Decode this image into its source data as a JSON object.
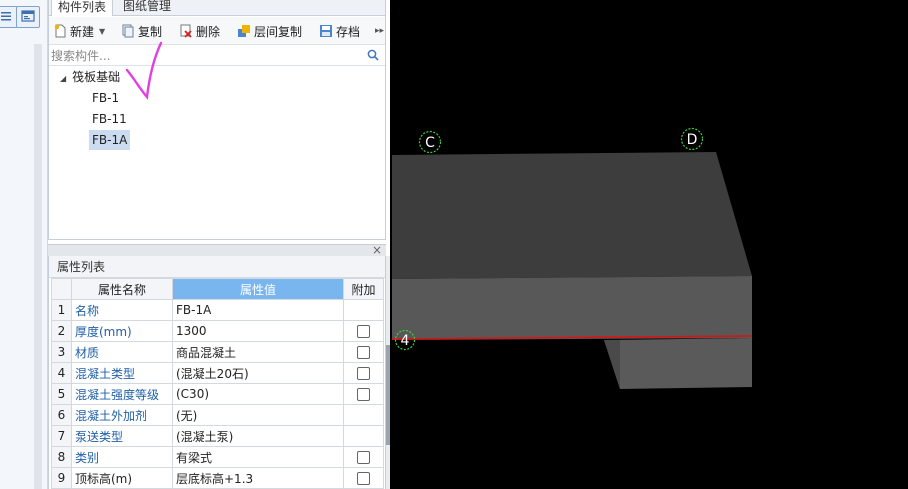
{
  "left_strip": {
    "buttons": [
      {
        "icon": "list-icon"
      },
      {
        "icon": "layout-icon"
      }
    ]
  },
  "component_panel": {
    "tabs": [
      {
        "label": "构件列表",
        "active": true
      },
      {
        "label": "图纸管理",
        "active": false
      }
    ],
    "toolbar": {
      "new_label": "新建",
      "copy_label": "复制",
      "delete_label": "删除",
      "floor_copy_label": "层间复制",
      "save_label": "存档",
      "more_label": "▸▸"
    },
    "search": {
      "placeholder": "搜索构件..."
    },
    "tree": {
      "root_label": "筏板基础",
      "items": [
        {
          "label": "FB-1",
          "selected": false
        },
        {
          "label": "FB-11",
          "selected": false
        },
        {
          "label": "FB-1A",
          "selected": true
        }
      ]
    }
  },
  "splitter": {
    "close_label": "×"
  },
  "property_panel": {
    "title": "属性列表",
    "headers": {
      "name": "属性名称",
      "value": "属性值",
      "extra": "附加"
    },
    "rows": [
      {
        "num": "1",
        "name": "名称",
        "value": "FB-1A",
        "checkbox": false
      },
      {
        "num": "2",
        "name": "厚度(mm)",
        "value": "1300",
        "checkbox": true
      },
      {
        "num": "3",
        "name": "材质",
        "value": "商品混凝土",
        "checkbox": true
      },
      {
        "num": "4",
        "name": "混凝土类型",
        "value": "(混凝土20石)",
        "checkbox": true
      },
      {
        "num": "5",
        "name": "混凝土强度等级",
        "value": "(C30)",
        "checkbox": true
      },
      {
        "num": "6",
        "name": "混凝土外加剂",
        "value": "(无)",
        "checkbox": false
      },
      {
        "num": "7",
        "name": "泵送类型",
        "value": "(混凝土泵)",
        "checkbox": false
      },
      {
        "num": "8",
        "name": "类别",
        "value": "有梁式",
        "checkbox": true
      },
      {
        "num": "9",
        "name": "顶标高(m)",
        "value": "层底标高+1.3",
        "checkbox": true
      }
    ]
  },
  "viewport": {
    "axis_labels": [
      "C",
      "D",
      "4"
    ],
    "colors": {
      "background": "#000000",
      "slab_top": "#3d3d3d",
      "slab_front": "#585858",
      "slab_side": "#4e4e4e",
      "lower_block": "#5a5a5a",
      "grid_line": "#e01010",
      "axis_marker": "#3ad33a",
      "annotation": "#e040e0"
    }
  }
}
